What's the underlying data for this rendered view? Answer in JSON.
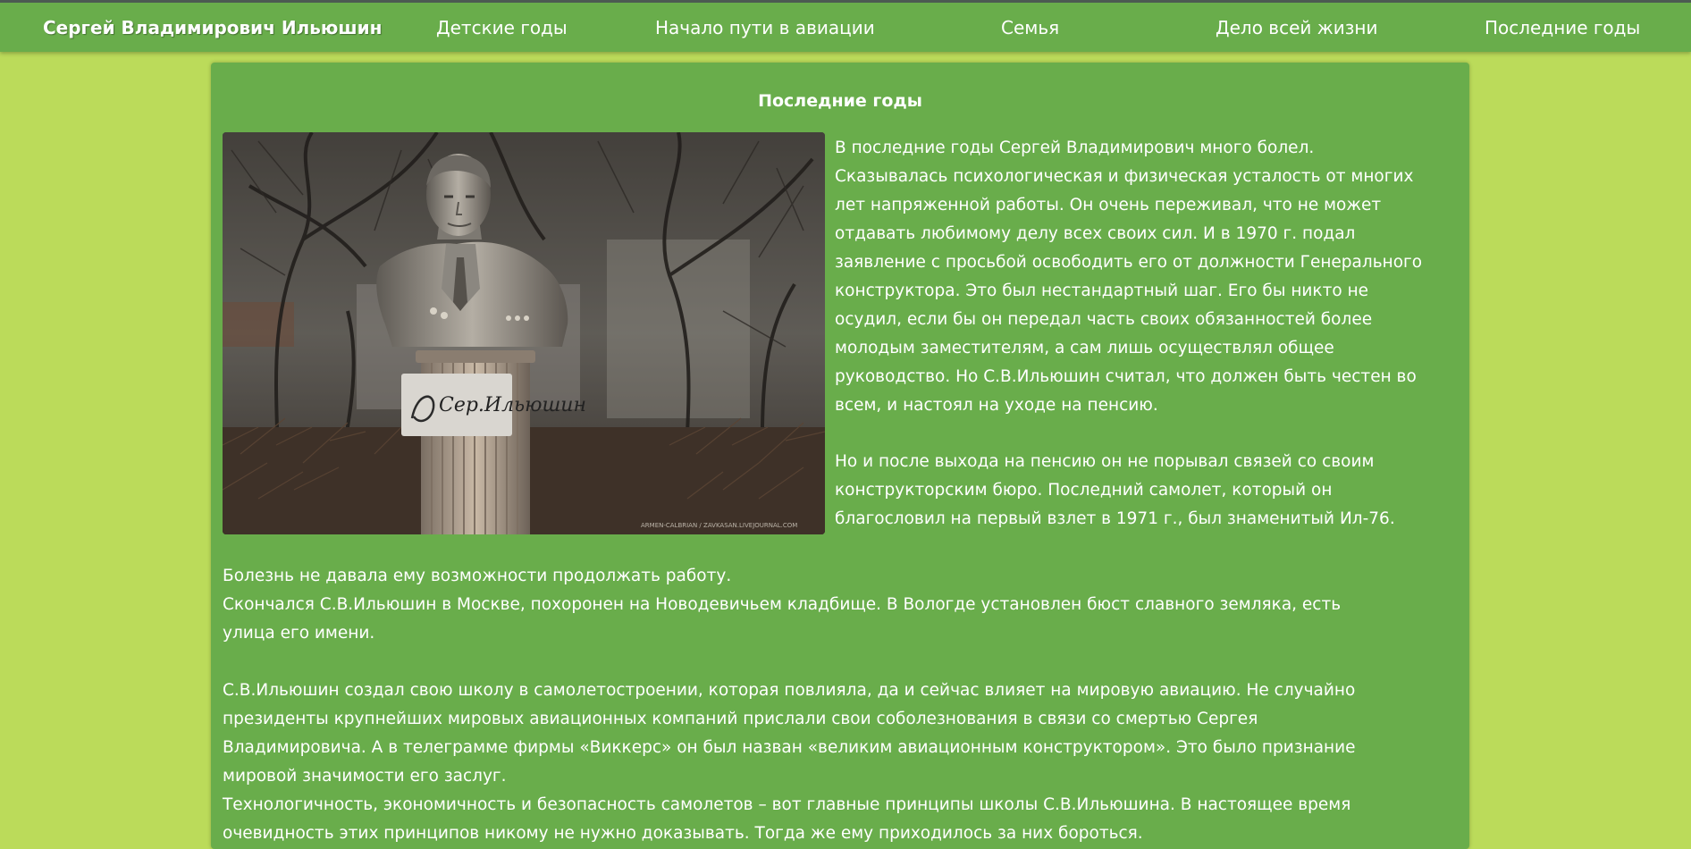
{
  "header": {
    "brand": "Сергей Владимирович Ильюшин",
    "nav": [
      "Детские годы",
      "Начало пути в авиации",
      "Семья",
      "Дело всей жизни",
      "Последние годы"
    ]
  },
  "main": {
    "title": "Последние годы",
    "photo": {
      "signature": "Сер.Ильюшин",
      "watermark": "ARMEN-CALBRIAN / ZAVKASAN.LIVEJOURNAL.COM"
    },
    "paragraphs": {
      "p1_lines": [
        "В последние годы Сергей Владимирович много болел.",
        "Сказывалась психологическая и физическая усталость от многих",
        "лет напряженной работы. Он очень переживал, что не может",
        "отдавать любимому делу всех своих сил. И в 1970 г. подал",
        "заявление с просьбой освободить его от должности Генерального",
        "конструктора. Это был нестандартный шаг. Его бы никто не",
        "осудил, если бы он передал часть своих обязанностей более",
        "молодым заместителям, а сам лишь осуществлял общее",
        "руководство. Но С.В.Ильюшин считал, что должен быть честен во",
        "всем, и настоял на уходе на пенсию."
      ],
      "p2_lines": [
        "Но и после выхода на пенсию он не порывал связей со своим",
        "конструкторским бюро. Последний самолет, который он",
        "благословил на первый взлет в 1971 г., был знаменитый Ил-76."
      ],
      "p3_lines": [
        "Болезнь не давала ему возможности продолжать работу.",
        "Скончался С.В.Ильюшин в Москве, похоронен на Новодевичьем кладбище. В Вологде установлен бюст славного земляка, есть",
        "улица его имени."
      ],
      "p4_lines": [
        "С.В.Ильюшин создал свою школу в самолетостроении, которая повлияла, да и сейчас влияет на мировую авиацию. Не случайно",
        "президенты крупнейших мировых авиационных компаний прислали свои соболезнования в связи со смертью Сергея",
        "Владимировича. А в телеграмме фирмы «Виккерс» он был назван «великим авиационным конструктором». Это было признание",
        "мировой значимости его заслуг.",
        "Технологичность, экономичность и безопасность самолетов – вот главные принципы школы С.В.Ильюшина. В настоящее время",
        "очевидность этих принципов никому не нужно доказывать. Тогда же ему приходилось за них бороться."
      ]
    }
  }
}
